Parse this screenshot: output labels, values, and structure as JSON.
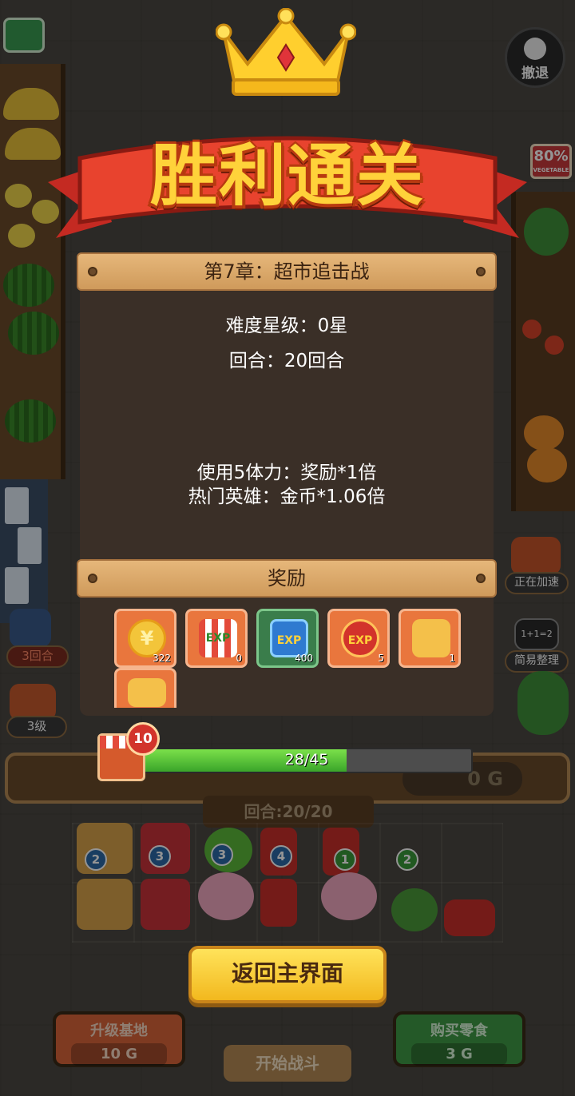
{
  "hud": {
    "undo_label": "撤退",
    "sale_sign": "80%",
    "sale_sign_sub": "VEGETABLE",
    "rounds_chip": "3回合",
    "level_chip": "3级",
    "speed_label": "正在加速",
    "sort_label": "简易整理",
    "sort_icon_text": "1+1=2",
    "gold_display": "0 G",
    "round_display": "回合:20/20"
  },
  "victory": {
    "title": "胜利通关",
    "chapter": "第7章：超市追击战",
    "difficulty": "难度星级：0星",
    "rounds": "回合：20回合",
    "stamina_bonus": "使用5体力：奖励*1倍",
    "hero_bonus": "热门英雄：金币*1.06倍",
    "reward_header": "奖励",
    "rewards": [
      {
        "icon": "gold-coin-icon",
        "count": "322"
      },
      {
        "icon": "shop-exp-icon",
        "label": "EXP",
        "count": "0"
      },
      {
        "icon": "blue-exp-icon",
        "label": "EXP",
        "count": "400"
      },
      {
        "icon": "orange-exp-badge-icon",
        "label": "EXP",
        "count": "5"
      },
      {
        "icon": "burger-card-icon",
        "count": "1"
      },
      {
        "icon": "hero-card-icon",
        "count": ""
      }
    ],
    "level": "10",
    "progress_current": 28,
    "progress_max": 45,
    "progress_text": "28/45",
    "return_button": "返回主界面"
  },
  "bottom_bar": {
    "upgrade_label": "升级基地",
    "upgrade_price": "10 G",
    "start_label": "开始战斗",
    "buy_label": "购买零食",
    "buy_price": "3 G"
  },
  "colors": {
    "panel_bg": "#3a2f27",
    "plank": "#e6b77a",
    "progress_fill": "#5cc83a",
    "return_button": "#f7cb2e",
    "title_fill": "#ffd23a",
    "title_outline": "#b83a10"
  }
}
